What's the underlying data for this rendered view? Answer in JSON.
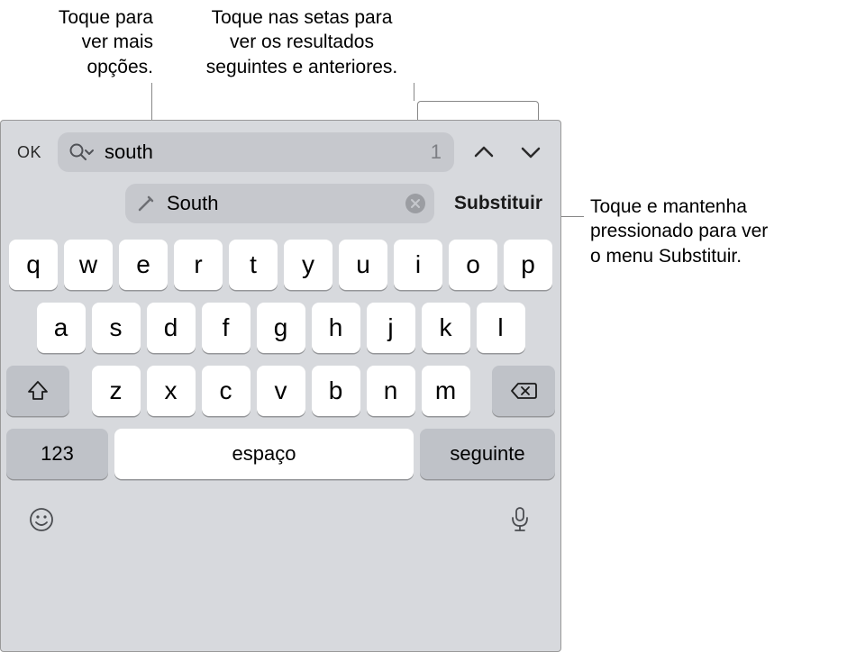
{
  "callouts": {
    "options": {
      "line1": "Toque para",
      "line2": "ver mais",
      "line3": "opções."
    },
    "arrows": {
      "line1": "Toque nas setas para",
      "line2": "ver os resultados",
      "line3": "seguintes e anteriores."
    },
    "replace": {
      "line1": "Toque e mantenha",
      "line2": "pressionado para ver",
      "line3": "o menu Substituir."
    }
  },
  "toolbar": {
    "ok_label": "OK",
    "find_value": "south",
    "find_count": "1",
    "replace_value": "South",
    "replace_label": "Substituir"
  },
  "keyboard": {
    "row1": [
      "q",
      "w",
      "e",
      "r",
      "t",
      "y",
      "u",
      "i",
      "o",
      "p"
    ],
    "row2": [
      "a",
      "s",
      "d",
      "f",
      "g",
      "h",
      "j",
      "k",
      "l"
    ],
    "row3": [
      "z",
      "x",
      "c",
      "v",
      "b",
      "n",
      "m"
    ],
    "num_label": "123",
    "space_label": "espaço",
    "next_label": "seguinte"
  },
  "icons": {
    "search": "search-icon",
    "chevron_small": "chevron-down-small-icon",
    "chevron_up": "chevron-up-icon",
    "chevron_down": "chevron-down-icon",
    "pencil": "pencil-icon",
    "clear": "clear-icon",
    "shift": "shift-icon",
    "backspace": "backspace-icon",
    "emoji": "emoji-icon",
    "mic": "mic-icon"
  },
  "colors": {
    "keyboard_bg": "#d7d9dd",
    "field_bg": "#c6c8cd",
    "modifier_key_bg": "#bfc2c8",
    "key_bg": "#ffffff"
  }
}
